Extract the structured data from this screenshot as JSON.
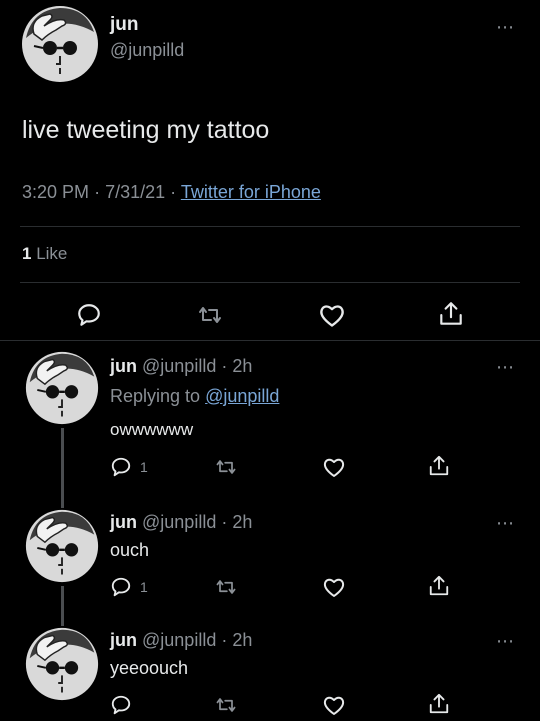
{
  "main_tweet": {
    "display_name": "jun",
    "handle": "@junpilld",
    "text": "live tweeting my tattoo",
    "time": "3:20 PM",
    "date": "7/31/21",
    "source": "Twitter for iPhone",
    "likes_count": "1",
    "likes_label": "Like"
  },
  "replies": [
    {
      "display_name": "jun",
      "handle_time": "@junpilld · 2h",
      "replying_prefix": "Replying to",
      "replying_to": "@junpilld",
      "text": "owwwwww",
      "reply_count": "1"
    },
    {
      "display_name": "jun",
      "handle_time": "@junpilld · 2h",
      "text": "ouch",
      "reply_count": "1"
    },
    {
      "display_name": "jun",
      "handle_time": "@junpilld · 2h",
      "text": "yeeoouch"
    }
  ],
  "more_icon": "⋯",
  "icons": {
    "reply": "reply-icon",
    "retweet": "retweet-icon",
    "like": "heart-icon",
    "share": "share-icon"
  },
  "colors": {
    "background": "#000000",
    "text": "#e7e9ea",
    "muted": "#8b9096",
    "link": "#7aa6d6"
  }
}
